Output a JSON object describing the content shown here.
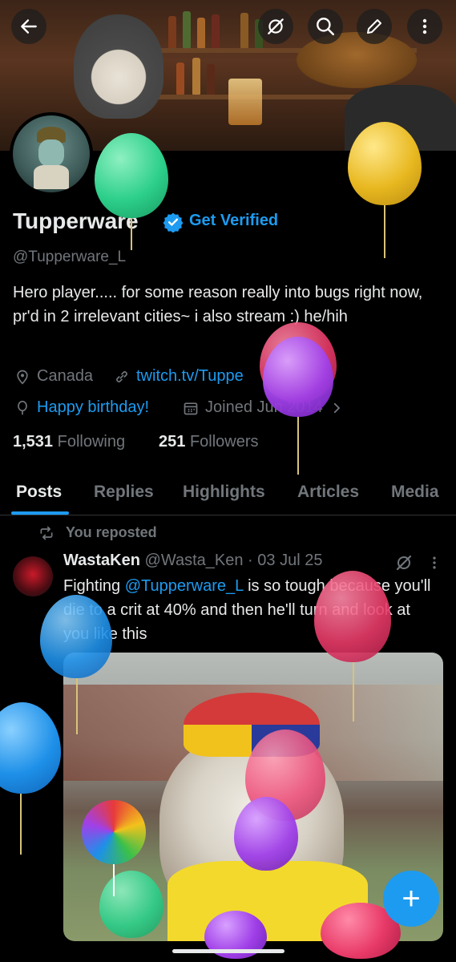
{
  "topbar": {
    "back_icon": "arrow-left-icon",
    "grok_icon": "grok-icon",
    "search_icon": "search-icon",
    "compose_icon": "pencil-icon",
    "more_icon": "more-vertical-icon"
  },
  "profile": {
    "name": "Tupperware",
    "verified_cta": "Get Verified",
    "handle": "@Tupperware_L",
    "bio": "Hero player..... for some reason really into bugs right now, pr'd in 2 irrelevant cities~ i also stream :) he/hih",
    "location": "Canada",
    "website": "twitch.tv/Tuppe",
    "birthday": "Happy birthday!",
    "joined": "Joined Jun  2014",
    "following_count": "1,531",
    "following_label": "Following",
    "followers_count": "251",
    "followers_label": "Followers"
  },
  "tabs": [
    "Posts",
    "Replies",
    "Highlights",
    "Articles",
    "Media"
  ],
  "active_tab": "Posts",
  "feed": {
    "repost_label": "You reposted",
    "tweet": {
      "author": "WastaKen",
      "handle": "@Wasta_Ken",
      "separator": "·",
      "date": "03 Jul 25",
      "text_before": "Fighting ",
      "mention": "@Tupperware_L",
      "text_after": " is so tough because you'll die to a crit at 40% and then he'll turn and look at you like this"
    }
  },
  "fab_label": "+",
  "colors": {
    "accent": "#1d9bf0",
    "background": "#000000",
    "text_primary": "#e7e9ea",
    "text_secondary": "#71767b"
  }
}
